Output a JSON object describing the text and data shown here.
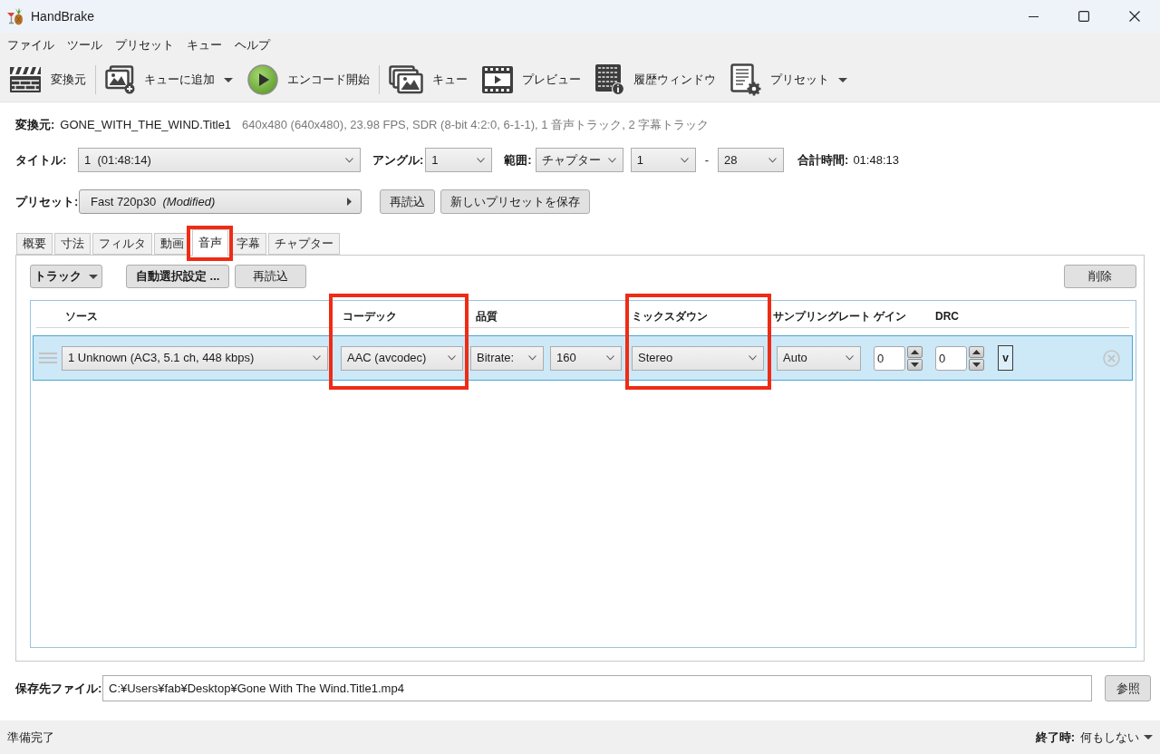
{
  "window": {
    "title": "HandBrake"
  },
  "menu": [
    "ファイル",
    "ツール",
    "プリセット",
    "キュー",
    "ヘルプ"
  ],
  "toolbar": [
    [
      {
        "kind": "source",
        "label": "変換元",
        "dropdown": false
      }
    ],
    [
      {
        "kind": "add_to_queue",
        "label": "キューに追加",
        "dropdown": true
      },
      {
        "kind": "start_encode",
        "label": "エンコード開始",
        "dropdown": false
      }
    ],
    [
      {
        "kind": "queue",
        "label": "キュー",
        "dropdown": false
      },
      {
        "kind": "preview",
        "label": "プレビュー",
        "dropdown": false
      },
      {
        "kind": "activity_log",
        "label": "履歴ウィンドウ",
        "dropdown": false
      },
      {
        "kind": "presets",
        "label": "プリセット",
        "dropdown": true
      }
    ]
  ],
  "source": {
    "label": "変換元:",
    "name": "GONE_WITH_THE_WIND.Title1",
    "info": "640x480 (640x480), 23.98 FPS, SDR (8-bit 4:2:0, 6-1-1), 1 音声トラック, 2 字幕トラック"
  },
  "title_row": {
    "title_label": "タイトル:",
    "title": "1  (01:48:14)",
    "angle_label": "アングル:",
    "angle": "1",
    "range_label": "範囲:",
    "range_mode": "チャプター",
    "range_start": "1",
    "range_separator": "-",
    "range_end": "28",
    "duration_label": "合計時間:",
    "duration": "01:48:13"
  },
  "preset_row": {
    "label": "プリセット:",
    "preset": "Fast 720p30  *(Modified)*",
    "reload": "再読込",
    "save_new": "新しいプリセットを保存"
  },
  "tabs": [
    {
      "label": "概要",
      "selected": false,
      "highlighted": false
    },
    {
      "label": "寸法",
      "selected": false,
      "highlighted": false
    },
    {
      "label": "フィルタ",
      "selected": false,
      "highlighted": false
    },
    {
      "label": "動画",
      "selected": false,
      "highlighted": false
    },
    {
      "label": "音声",
      "selected": true,
      "highlighted": true
    },
    {
      "label": "字幕",
      "selected": false,
      "highlighted": false
    },
    {
      "label": "チャプター",
      "selected": false,
      "highlighted": false
    }
  ],
  "audio": {
    "track_menu": "トラック",
    "auto_select": "自動選択設定 ...",
    "reload": "再読込",
    "remove": "削除",
    "columns": [
      {
        "label": "ソース",
        "highlighted": false
      },
      {
        "label": "コーデック",
        "highlighted": true
      },
      {
        "label": "品質",
        "highlighted": false
      },
      {
        "label": "ミックスダウン",
        "highlighted": true
      },
      {
        "label": "サンプリングレート",
        "highlighted": false
      },
      {
        "label": "ゲイン",
        "highlighted": false
      },
      {
        "label": "DRC",
        "highlighted": false
      }
    ],
    "tracks": [
      {
        "selected": true,
        "source": "1 Unknown (AC3, 5.1 ch, 448 kbps)",
        "codec": "AAC (avcodec)",
        "quality_mode": "Bitrate:",
        "bitrate": "160",
        "mixdown": "Stereo",
        "samplerate": "Auto",
        "gain": "0",
        "drc": "0",
        "extra": "v"
      }
    ]
  },
  "destination": {
    "label": "保存先ファイル:",
    "path": "C:¥Users¥fab¥Desktop¥Gone With The Wind.Title1.mp4",
    "browse": "参照"
  },
  "status_bar": {
    "status": "準備完了",
    "when_done_label": "終了時:",
    "when_done": "何もしない"
  }
}
